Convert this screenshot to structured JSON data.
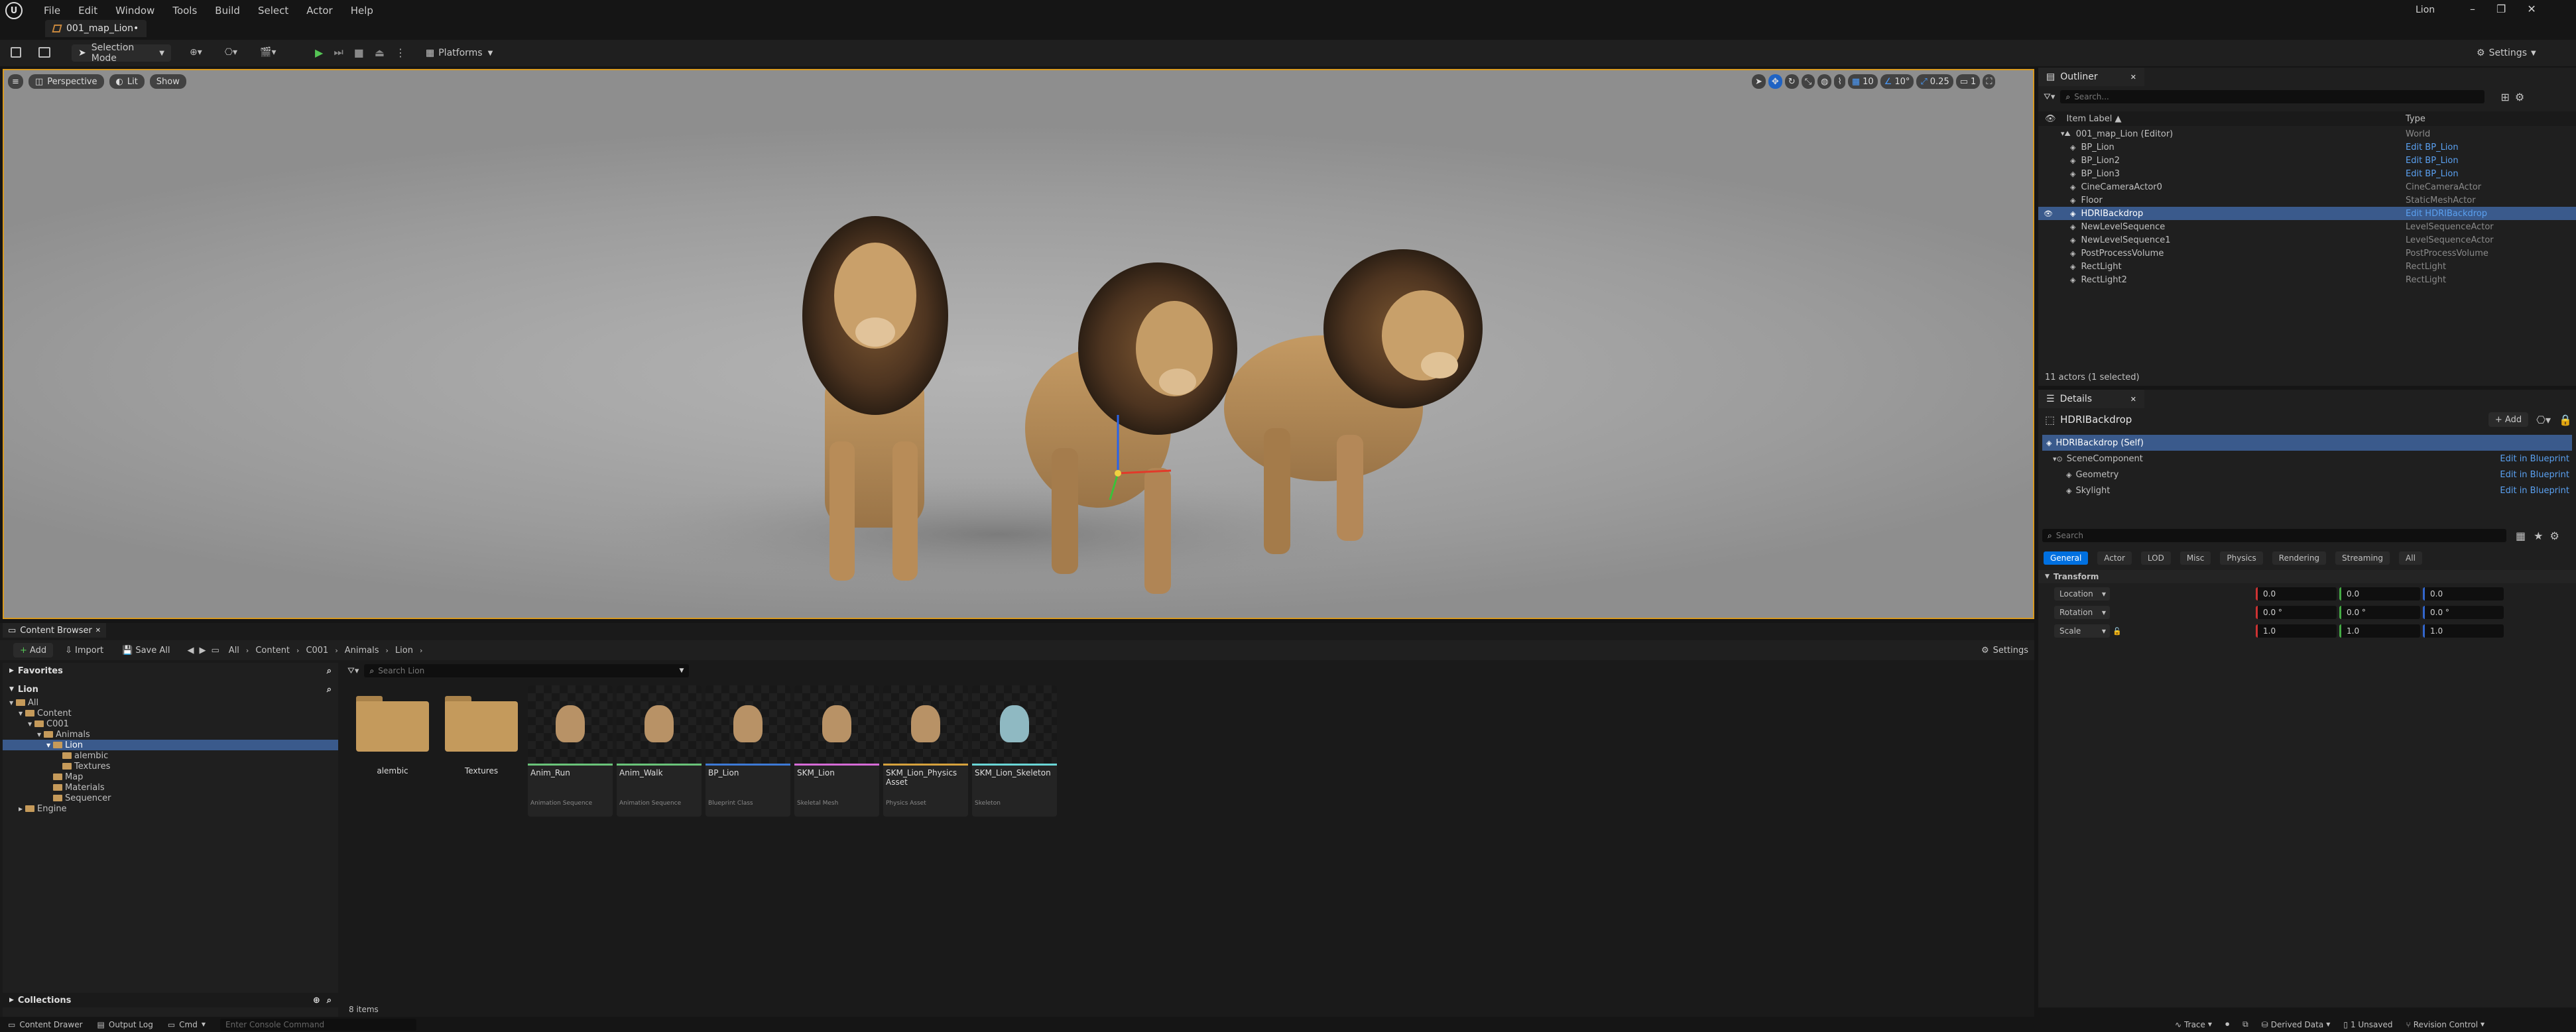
{
  "menu": [
    "File",
    "Edit",
    "Window",
    "Tools",
    "Build",
    "Select",
    "Actor",
    "Help"
  ],
  "project_name": "Lion",
  "map_tab": "001_map_Lion•",
  "toolbar": {
    "selection_mode": "Selection Mode",
    "platforms": "Platforms",
    "settings": "Settings"
  },
  "viewport": {
    "perspective": "Perspective",
    "lit": "Lit",
    "show": "Show",
    "grid_snap": "10",
    "rot_snap": "10°",
    "scale_snap": "0.25",
    "cam_speed": "1"
  },
  "outliner": {
    "tab": "Outliner",
    "search_placeholder": "Search...",
    "col_label": "Item Label ▲",
    "col_type": "Type",
    "rows": [
      {
        "label": "001_map_Lion (Editor)",
        "type": "World",
        "link": false,
        "sel": false
      },
      {
        "label": "BP_Lion",
        "type": "Edit BP_Lion",
        "link": true,
        "sel": false
      },
      {
        "label": "BP_Lion2",
        "type": "Edit BP_Lion",
        "link": true,
        "sel": false
      },
      {
        "label": "BP_Lion3",
        "type": "Edit BP_Lion",
        "link": true,
        "sel": false
      },
      {
        "label": "CineCameraActor0",
        "type": "CineCameraActor",
        "link": false,
        "sel": false
      },
      {
        "label": "Floor",
        "type": "StaticMeshActor",
        "link": false,
        "sel": false
      },
      {
        "label": "HDRIBackdrop",
        "type": "Edit HDRIBackdrop",
        "link": true,
        "sel": true
      },
      {
        "label": "NewLevelSequence",
        "type": "LevelSequenceActor",
        "link": false,
        "sel": false
      },
      {
        "label": "NewLevelSequence1",
        "type": "LevelSequenceActor",
        "link": false,
        "sel": false
      },
      {
        "label": "PostProcessVolume",
        "type": "PostProcessVolume",
        "link": false,
        "sel": false
      },
      {
        "label": "RectLight",
        "type": "RectLight",
        "link": false,
        "sel": false
      },
      {
        "label": "RectLight2",
        "type": "RectLight",
        "link": false,
        "sel": false
      }
    ],
    "status": "11 actors (1 selected)"
  },
  "details": {
    "tab": "Details",
    "actor": "HDRIBackdrop",
    "add": "+ Add",
    "components": [
      {
        "label": "HDRIBackdrop (Self)",
        "action": ""
      },
      {
        "label": "SceneComponent",
        "action": "Edit in Blueprint"
      },
      {
        "label": "Geometry",
        "action": "Edit in Blueprint"
      },
      {
        "label": "Skylight",
        "action": "Edit in Blueprint"
      }
    ],
    "search_placeholder": "Search",
    "filters": [
      "General",
      "Actor",
      "LOD",
      "Misc",
      "Physics",
      "Rendering",
      "Streaming",
      "All"
    ],
    "section": "Transform",
    "transform": [
      {
        "label": "Location",
        "x": "0.0",
        "y": "0.0",
        "z": "0.0"
      },
      {
        "label": "Rotation",
        "x": "0.0 °",
        "y": "0.0 °",
        "z": "0.0 °"
      },
      {
        "label": "Scale",
        "x": "1.0",
        "y": "1.0",
        "z": "1.0"
      }
    ]
  },
  "content_browser": {
    "tab": "Content Browser",
    "add": "Add",
    "import": "Import",
    "save_all": "Save All",
    "breadcrumb": [
      "All",
      "Content",
      "C001",
      "Animals",
      "Lion"
    ],
    "settings": "Settings",
    "favorites": "Favorites",
    "lion_section": "Lion",
    "tree": [
      {
        "label": "All",
        "depth": 0
      },
      {
        "label": "Content",
        "depth": 1
      },
      {
        "label": "C001",
        "depth": 2
      },
      {
        "label": "Animals",
        "depth": 3
      },
      {
        "label": "Lion",
        "depth": 4
      },
      {
        "label": "alembic",
        "depth": 5
      },
      {
        "label": "Textures",
        "depth": 5
      },
      {
        "label": "Map",
        "depth": 4
      },
      {
        "label": "Materials",
        "depth": 4
      },
      {
        "label": "Sequencer",
        "depth": 4
      },
      {
        "label": "Engine",
        "depth": 1
      }
    ],
    "search_placeholder": "Search Lion",
    "folders": [
      "alembic",
      "Textures"
    ],
    "assets": [
      {
        "name": "Anim_Run",
        "type": "Animation Sequence",
        "color": "#6ac47a"
      },
      {
        "name": "Anim_Walk",
        "type": "Animation Sequence",
        "color": "#6ac47a"
      },
      {
        "name": "BP_Lion",
        "type": "Blueprint Class",
        "color": "#3d7ad6"
      },
      {
        "name": "SKM_Lion",
        "type": "Skeletal Mesh",
        "color": "#d66bd6"
      },
      {
        "name": "SKM_Lion_Physics Asset",
        "type": "Physics Asset",
        "color": "#d6a23d"
      },
      {
        "name": "SKM_Lion_Skeleton",
        "type": "Skeleton",
        "color": "#6ad6d6"
      }
    ],
    "item_count": "8 items",
    "collections": "Collections"
  },
  "statusbar": {
    "content_drawer": "Content Drawer",
    "output_log": "Output Log",
    "cmd": "Cmd",
    "console_placeholder": "Enter Console Command",
    "trace": "Trace",
    "derived_data": "Derived Data",
    "unsaved": "1 Unsaved",
    "revision_control": "Revision Control"
  },
  "colors": {
    "accent": "#0070e0",
    "selection": "#3a5a8c",
    "viewport_border": "#d89a21",
    "link": "#5aa0f0"
  }
}
